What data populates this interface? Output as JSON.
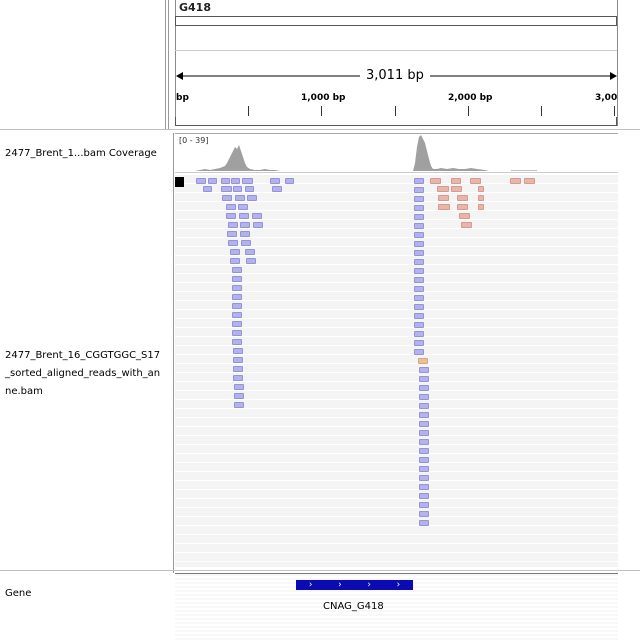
{
  "ruler": {
    "chrom": "G418",
    "span_label": "3,011 bp",
    "ticks": [
      {
        "label": "bp"
      },
      {
        "label": "1,000 bp"
      },
      {
        "label": "2,000 bp"
      },
      {
        "label": "3,00"
      }
    ]
  },
  "tracks": {
    "coverage_label": "2477_Brent_1...bam Coverage",
    "coverage_range": "[0 - 39]",
    "alignment_label": "2477_Brent_16_CGGTGGC_S17_sorted_aligned_reads_with_anne.bam",
    "gene_label": "Gene",
    "gene_name": "CNAG_G418",
    "gene_strand_glyphs": [
      "›",
      "›",
      "›",
      "›"
    ]
  },
  "colors": {
    "forward_read": "#b4b2ee",
    "reverse_read": "#e8b5aa",
    "gene": "#0b0bb3",
    "coverage": "#a0a0a0"
  }
}
